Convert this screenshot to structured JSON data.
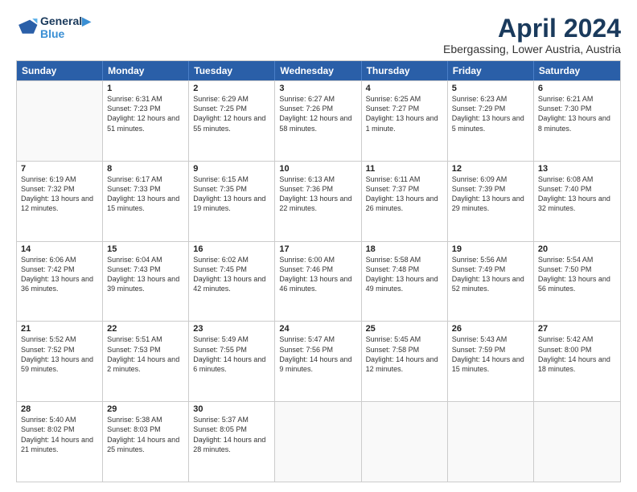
{
  "header": {
    "logo_line1": "General",
    "logo_line2": "Blue",
    "title": "April 2024",
    "subtitle": "Ebergassing, Lower Austria, Austria"
  },
  "days_of_week": [
    "Sunday",
    "Monday",
    "Tuesday",
    "Wednesday",
    "Thursday",
    "Friday",
    "Saturday"
  ],
  "weeks": [
    [
      {
        "day": "",
        "empty": true
      },
      {
        "day": "1",
        "sunrise": "Sunrise: 6:31 AM",
        "sunset": "Sunset: 7:23 PM",
        "daylight": "Daylight: 12 hours and 51 minutes."
      },
      {
        "day": "2",
        "sunrise": "Sunrise: 6:29 AM",
        "sunset": "Sunset: 7:25 PM",
        "daylight": "Daylight: 12 hours and 55 minutes."
      },
      {
        "day": "3",
        "sunrise": "Sunrise: 6:27 AM",
        "sunset": "Sunset: 7:26 PM",
        "daylight": "Daylight: 12 hours and 58 minutes."
      },
      {
        "day": "4",
        "sunrise": "Sunrise: 6:25 AM",
        "sunset": "Sunset: 7:27 PM",
        "daylight": "Daylight: 13 hours and 1 minute."
      },
      {
        "day": "5",
        "sunrise": "Sunrise: 6:23 AM",
        "sunset": "Sunset: 7:29 PM",
        "daylight": "Daylight: 13 hours and 5 minutes."
      },
      {
        "day": "6",
        "sunrise": "Sunrise: 6:21 AM",
        "sunset": "Sunset: 7:30 PM",
        "daylight": "Daylight: 13 hours and 8 minutes."
      }
    ],
    [
      {
        "day": "7",
        "sunrise": "Sunrise: 6:19 AM",
        "sunset": "Sunset: 7:32 PM",
        "daylight": "Daylight: 13 hours and 12 minutes."
      },
      {
        "day": "8",
        "sunrise": "Sunrise: 6:17 AM",
        "sunset": "Sunset: 7:33 PM",
        "daylight": "Daylight: 13 hours and 15 minutes."
      },
      {
        "day": "9",
        "sunrise": "Sunrise: 6:15 AM",
        "sunset": "Sunset: 7:35 PM",
        "daylight": "Daylight: 13 hours and 19 minutes."
      },
      {
        "day": "10",
        "sunrise": "Sunrise: 6:13 AM",
        "sunset": "Sunset: 7:36 PM",
        "daylight": "Daylight: 13 hours and 22 minutes."
      },
      {
        "day": "11",
        "sunrise": "Sunrise: 6:11 AM",
        "sunset": "Sunset: 7:37 PM",
        "daylight": "Daylight: 13 hours and 26 minutes."
      },
      {
        "day": "12",
        "sunrise": "Sunrise: 6:09 AM",
        "sunset": "Sunset: 7:39 PM",
        "daylight": "Daylight: 13 hours and 29 minutes."
      },
      {
        "day": "13",
        "sunrise": "Sunrise: 6:08 AM",
        "sunset": "Sunset: 7:40 PM",
        "daylight": "Daylight: 13 hours and 32 minutes."
      }
    ],
    [
      {
        "day": "14",
        "sunrise": "Sunrise: 6:06 AM",
        "sunset": "Sunset: 7:42 PM",
        "daylight": "Daylight: 13 hours and 36 minutes."
      },
      {
        "day": "15",
        "sunrise": "Sunrise: 6:04 AM",
        "sunset": "Sunset: 7:43 PM",
        "daylight": "Daylight: 13 hours and 39 minutes."
      },
      {
        "day": "16",
        "sunrise": "Sunrise: 6:02 AM",
        "sunset": "Sunset: 7:45 PM",
        "daylight": "Daylight: 13 hours and 42 minutes."
      },
      {
        "day": "17",
        "sunrise": "Sunrise: 6:00 AM",
        "sunset": "Sunset: 7:46 PM",
        "daylight": "Daylight: 13 hours and 46 minutes."
      },
      {
        "day": "18",
        "sunrise": "Sunrise: 5:58 AM",
        "sunset": "Sunset: 7:48 PM",
        "daylight": "Daylight: 13 hours and 49 minutes."
      },
      {
        "day": "19",
        "sunrise": "Sunrise: 5:56 AM",
        "sunset": "Sunset: 7:49 PM",
        "daylight": "Daylight: 13 hours and 52 minutes."
      },
      {
        "day": "20",
        "sunrise": "Sunrise: 5:54 AM",
        "sunset": "Sunset: 7:50 PM",
        "daylight": "Daylight: 13 hours and 56 minutes."
      }
    ],
    [
      {
        "day": "21",
        "sunrise": "Sunrise: 5:52 AM",
        "sunset": "Sunset: 7:52 PM",
        "daylight": "Daylight: 13 hours and 59 minutes."
      },
      {
        "day": "22",
        "sunrise": "Sunrise: 5:51 AM",
        "sunset": "Sunset: 7:53 PM",
        "daylight": "Daylight: 14 hours and 2 minutes."
      },
      {
        "day": "23",
        "sunrise": "Sunrise: 5:49 AM",
        "sunset": "Sunset: 7:55 PM",
        "daylight": "Daylight: 14 hours and 6 minutes."
      },
      {
        "day": "24",
        "sunrise": "Sunrise: 5:47 AM",
        "sunset": "Sunset: 7:56 PM",
        "daylight": "Daylight: 14 hours and 9 minutes."
      },
      {
        "day": "25",
        "sunrise": "Sunrise: 5:45 AM",
        "sunset": "Sunset: 7:58 PM",
        "daylight": "Daylight: 14 hours and 12 minutes."
      },
      {
        "day": "26",
        "sunrise": "Sunrise: 5:43 AM",
        "sunset": "Sunset: 7:59 PM",
        "daylight": "Daylight: 14 hours and 15 minutes."
      },
      {
        "day": "27",
        "sunrise": "Sunrise: 5:42 AM",
        "sunset": "Sunset: 8:00 PM",
        "daylight": "Daylight: 14 hours and 18 minutes."
      }
    ],
    [
      {
        "day": "28",
        "sunrise": "Sunrise: 5:40 AM",
        "sunset": "Sunset: 8:02 PM",
        "daylight": "Daylight: 14 hours and 21 minutes."
      },
      {
        "day": "29",
        "sunrise": "Sunrise: 5:38 AM",
        "sunset": "Sunset: 8:03 PM",
        "daylight": "Daylight: 14 hours and 25 minutes."
      },
      {
        "day": "30",
        "sunrise": "Sunrise: 5:37 AM",
        "sunset": "Sunset: 8:05 PM",
        "daylight": "Daylight: 14 hours and 28 minutes."
      },
      {
        "day": "",
        "empty": true
      },
      {
        "day": "",
        "empty": true
      },
      {
        "day": "",
        "empty": true
      },
      {
        "day": "",
        "empty": true
      }
    ]
  ]
}
